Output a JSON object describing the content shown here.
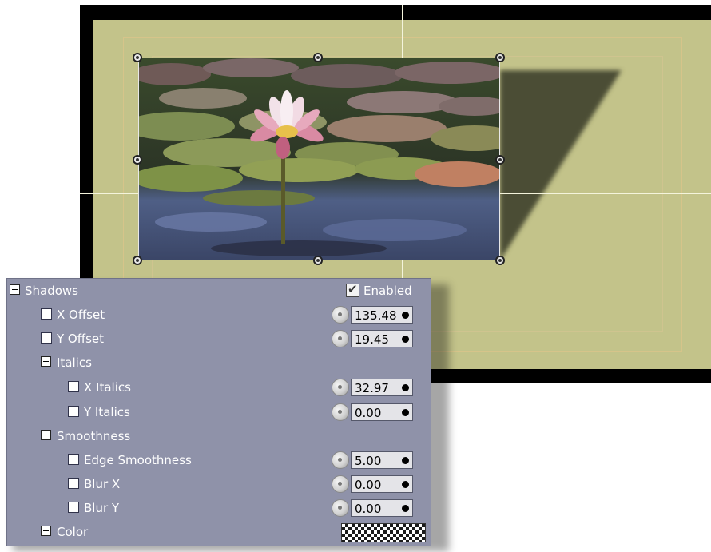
{
  "canvas": {
    "colors": {
      "frame": "#000000",
      "background": "#c3c38a",
      "shadow": "#4b4e34",
      "guide": "#f4f4dc"
    },
    "image_subject": "pink water lily on pond with lily pads",
    "transform_handles": 8
  },
  "panel": {
    "background_color": "#8f92a9",
    "rows": [
      {
        "key": "shadows",
        "label": "Shadows",
        "kind": "group",
        "expanded": true,
        "enabled_label": "Enabled",
        "enabled": true
      },
      {
        "key": "x_offset",
        "label": "X Offset",
        "kind": "param",
        "checked": false,
        "value": "135.48"
      },
      {
        "key": "y_offset",
        "label": "Y Offset",
        "kind": "param",
        "checked": false,
        "value": "19.45"
      },
      {
        "key": "italics",
        "label": "Italics",
        "kind": "group",
        "expanded": true
      },
      {
        "key": "x_italics",
        "label": "X Italics",
        "kind": "param",
        "checked": false,
        "value": "32.97"
      },
      {
        "key": "y_italics",
        "label": "Y Italics",
        "kind": "param",
        "checked": false,
        "value": "0.00"
      },
      {
        "key": "smoothness",
        "label": "Smoothness",
        "kind": "group",
        "expanded": true
      },
      {
        "key": "edge_smoothness",
        "label": "Edge Smoothness",
        "kind": "param",
        "checked": false,
        "value": "5.00"
      },
      {
        "key": "blur_x",
        "label": "Blur X",
        "kind": "param",
        "checked": false,
        "value": "0.00"
      },
      {
        "key": "blur_y",
        "label": "Blur Y",
        "kind": "param",
        "checked": false,
        "value": "0.00"
      },
      {
        "key": "color",
        "label": "Color",
        "kind": "group",
        "expanded": false,
        "swatch": "checkerboard"
      }
    ]
  }
}
